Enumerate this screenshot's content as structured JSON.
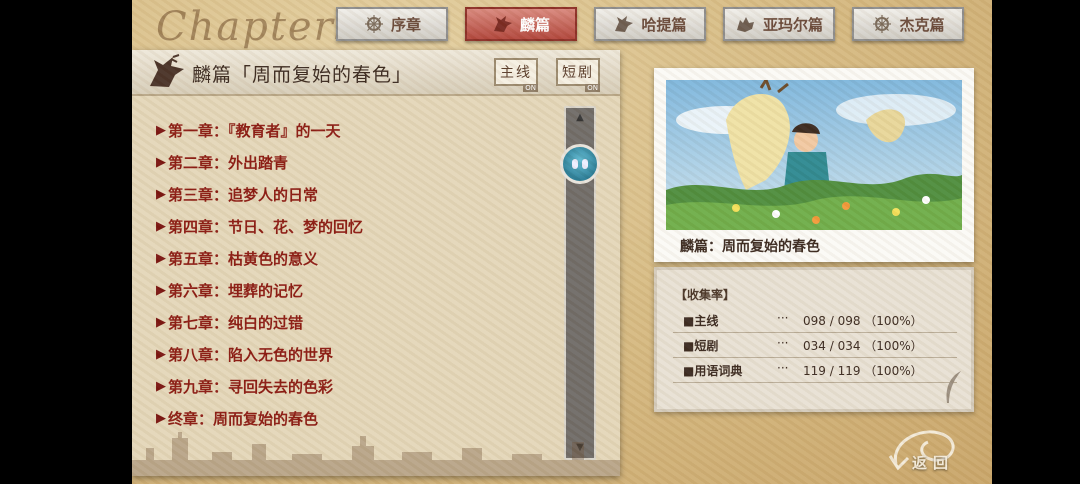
{
  "logo": "Chapters",
  "tabs": [
    {
      "label": "序章",
      "icon": "compass-icon"
    },
    {
      "label": "麟篇",
      "icon": "qilin-icon",
      "active": true
    },
    {
      "label": "哈提篇",
      "icon": "qilin-icon"
    },
    {
      "label": "亚玛尔篇",
      "icon": "wolf-icon"
    },
    {
      "label": "杰克篇",
      "icon": "compass-icon"
    }
  ],
  "panel": {
    "title": "麟篇「周而复始的春色」",
    "toggles": [
      {
        "label": "主线",
        "state": "ON"
      },
      {
        "label": "短剧",
        "state": "ON"
      }
    ],
    "chapters": [
      "第一章：『教育者』的一天",
      "第二章：外出踏青",
      "第三章：追梦人的日常",
      "第四章：节日、花、梦的回忆",
      "第五章：枯黄色的意义",
      "第六章：埋葬的记忆",
      "第七章：纯白的过错",
      "第八章：陷入无色的世界",
      "第九章：寻回失去的色彩",
      "终章：周而复始的春色"
    ],
    "arrow": "▶"
  },
  "preview": {
    "caption": "麟篇：周而复始的春色"
  },
  "stats": {
    "title": "【收集率】",
    "rows": [
      {
        "label": "■主线",
        "dots": "···",
        "value": "098 / 098 （100%）"
      },
      {
        "label": "■短剧",
        "dots": "···",
        "value": "034 / 034 （100%）"
      },
      {
        "label": "■用语词典",
        "dots": "···",
        "value": "119 / 119 （100%）"
      }
    ]
  },
  "back_label": "返回",
  "colors": {
    "accent": "#b2473d",
    "chapter_text": "#8b1a12",
    "scroll_knob": "#2a7d97"
  }
}
